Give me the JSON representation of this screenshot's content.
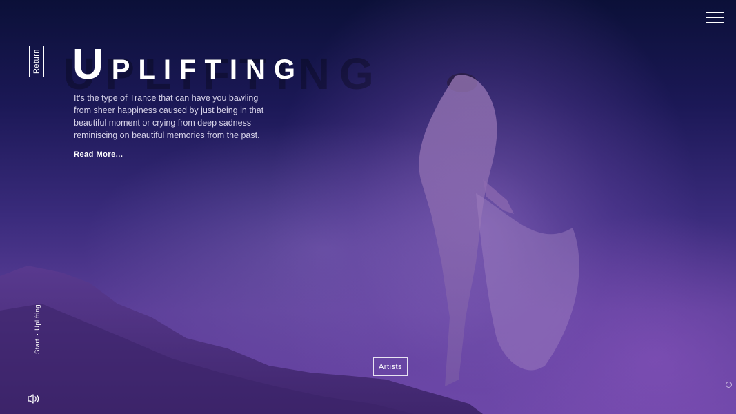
{
  "header": {
    "menu_icon": "hamburger-menu-icon"
  },
  "nav": {
    "return_label": "Return"
  },
  "hero": {
    "title_initial": "U",
    "title_rest": "PLIFTING",
    "ghost_title": "UPLIFTING",
    "description": "It’s the type of Trance that can have you bawling from sheer happiness caused by just being in that beautiful moment or crying from deep sadness reminiscing on beautiful memories from the past.",
    "read_more": "Read More..."
  },
  "breadcrumb": {
    "start": "Start",
    "current": "Uplifting"
  },
  "footer": {
    "artists_label": "Artists",
    "sound_icon": "speaker-sound-icon",
    "scroll_icon": "circle-indicator-icon"
  },
  "colors": {
    "background_top": "#0b1038",
    "background_bottom": "#6a45a5",
    "text": "#ffffff",
    "muted_text": "#d8d4ea"
  }
}
